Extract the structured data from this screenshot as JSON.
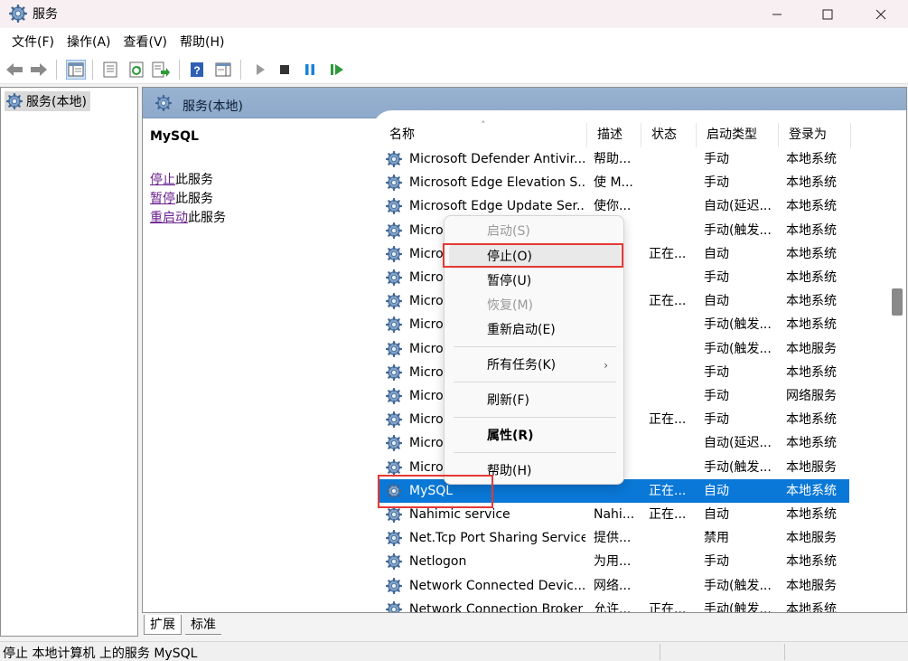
{
  "window": {
    "title": "服务",
    "min_icon": "minimize-icon",
    "max_icon": "maximize-icon",
    "close_icon": "close-icon"
  },
  "menubar": [
    "文件(F)",
    "操作(A)",
    "查看(V)",
    "帮助(H)"
  ],
  "toolbar": [
    "back-arrow-icon",
    "forward-arrow-icon",
    "show-console-tree-icon",
    "properties-icon",
    "refresh-icon",
    "export-list-icon",
    "help-icon",
    "show-action-pane-icon",
    "start-service-icon",
    "stop-service-icon",
    "pause-service-icon",
    "restart-service-icon"
  ],
  "tree": {
    "root_label": "服务(本地)"
  },
  "pane": {
    "header_title": "服务(本地)",
    "selected_service": "MySQL",
    "action_stop_link": "停止",
    "action_stop_suffix": "此服务",
    "action_pause_link": "暂停",
    "action_pause_suffix": "此服务",
    "action_restart_link": "重启动",
    "action_restart_suffix": "此服务"
  },
  "table": {
    "columns": [
      "名称",
      "描述",
      "状态",
      "启动类型",
      "登录为"
    ],
    "rows": [
      {
        "name": "Microsoft Defender Antivir...",
        "desc": "帮助...",
        "status": "",
        "startup": "手动",
        "logon": "本地系统"
      },
      {
        "name": "Microsoft Edge Elevation S...",
        "desc": "使 M...",
        "status": "",
        "startup": "手动",
        "logon": "本地系统"
      },
      {
        "name": "Microsoft Edge Update Ser...",
        "desc": "使你...",
        "status": "",
        "startup": "自动(延迟...",
        "logon": "本地系统"
      },
      {
        "name": "Micro",
        "desc": "...",
        "status": "",
        "startup": "手动(触发...",
        "logon": "本地系统"
      },
      {
        "name": "Micro",
        "desc": "...",
        "status": "正在...",
        "startup": "自动",
        "logon": "本地系统"
      },
      {
        "name": "Micro",
        "desc": "...",
        "status": "",
        "startup": "手动",
        "logon": "本地系统"
      },
      {
        "name": "Micro",
        "desc": "...",
        "status": "正在...",
        "startup": "自动",
        "logon": "本地系统"
      },
      {
        "name": "Micro",
        "desc": "...",
        "status": "",
        "startup": "手动(触发...",
        "logon": "本地系统"
      },
      {
        "name": "Micro",
        "desc": "...",
        "status": "",
        "startup": "手动(触发...",
        "logon": "本地服务"
      },
      {
        "name": "Micro",
        "desc": "...",
        "status": "",
        "startup": "手动",
        "logon": "本地系统"
      },
      {
        "name": "Micro",
        "desc": "...",
        "status": "",
        "startup": "手动",
        "logon": "网络服务"
      },
      {
        "name": "Micro",
        "desc": "...",
        "status": "正在...",
        "startup": "手动",
        "logon": "本地系统"
      },
      {
        "name": "Micro",
        "desc": "...",
        "status": "",
        "startup": "自动(延迟...",
        "logon": "本地系统"
      },
      {
        "name": "Micro",
        "desc": "...",
        "status": "",
        "startup": "手动(触发...",
        "logon": "本地服务"
      },
      {
        "name": "MySQL",
        "desc": "",
        "status": "正在...",
        "startup": "自动",
        "logon": "本地系统",
        "selected": true
      },
      {
        "name": "Nahimic service",
        "desc": "Nahi...",
        "status": "正在...",
        "startup": "自动",
        "logon": "本地系统"
      },
      {
        "name": "Net.Tcp Port Sharing Service",
        "desc": "提供...",
        "status": "",
        "startup": "禁用",
        "logon": "本地服务"
      },
      {
        "name": "Netlogon",
        "desc": "为用...",
        "status": "",
        "startup": "手动",
        "logon": "本地系统"
      },
      {
        "name": "Network Connected Devic...",
        "desc": "网络...",
        "status": "",
        "startup": "手动(触发...",
        "logon": "本地服务"
      },
      {
        "name": "Network Connection Broker",
        "desc": "允许...",
        "status": "正在...",
        "startup": "手动(触发...",
        "logon": "本地系统"
      }
    ]
  },
  "context_menu": {
    "start": "启动(S)",
    "stop": "停止(O)",
    "pause": "暂停(U)",
    "resume": "恢复(M)",
    "restart": "重新启动(E)",
    "all_tasks": "所有任务(K)",
    "all_tasks_arrow": "›",
    "refresh": "刷新(F)",
    "properties": "属性(R)",
    "help": "帮助(H)"
  },
  "tabs": {
    "extended": "扩展",
    "standard": "标准"
  },
  "statusbar": {
    "text": "停止 本地计算机 上的服务 MySQL"
  },
  "colors": {
    "selection": "#0a78d7",
    "link": "#6a1f8d",
    "highlight_box": "#e53935",
    "header_gradient": "#8ea9cb"
  }
}
